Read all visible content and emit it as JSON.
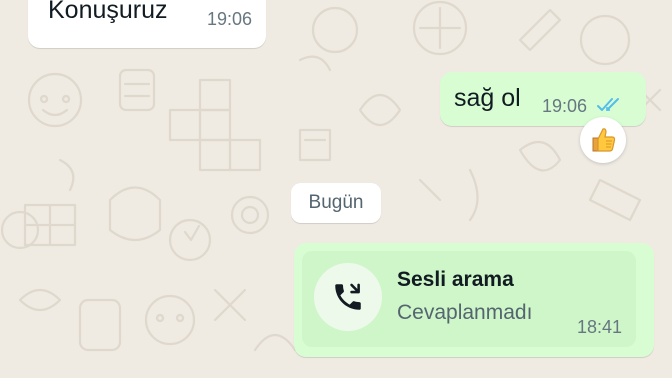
{
  "chat": {
    "messages": [
      {
        "direction": "incoming",
        "text": "Konuşuruz",
        "time": "19:06"
      },
      {
        "direction": "outgoing",
        "text": "sağ ol",
        "time": "19:06",
        "status": "read"
      }
    ],
    "reaction": {
      "emoji": "👍",
      "icon": "thumbs-up-icon"
    },
    "date_separator": "Bugün",
    "call": {
      "direction": "outgoing",
      "title": "Sesli arama",
      "status": "Cevaplanmadı",
      "time": "18:41",
      "icon": "phone-missed-call-icon"
    }
  },
  "colors": {
    "wallpaper": "#efeae2",
    "incoming_bubble": "#ffffff",
    "outgoing_bubble": "#d9fdd3",
    "call_card": "#cff6c8",
    "read_ticks": "#53bdeb",
    "text_primary": "#111b21",
    "text_secondary": "#667781"
  }
}
